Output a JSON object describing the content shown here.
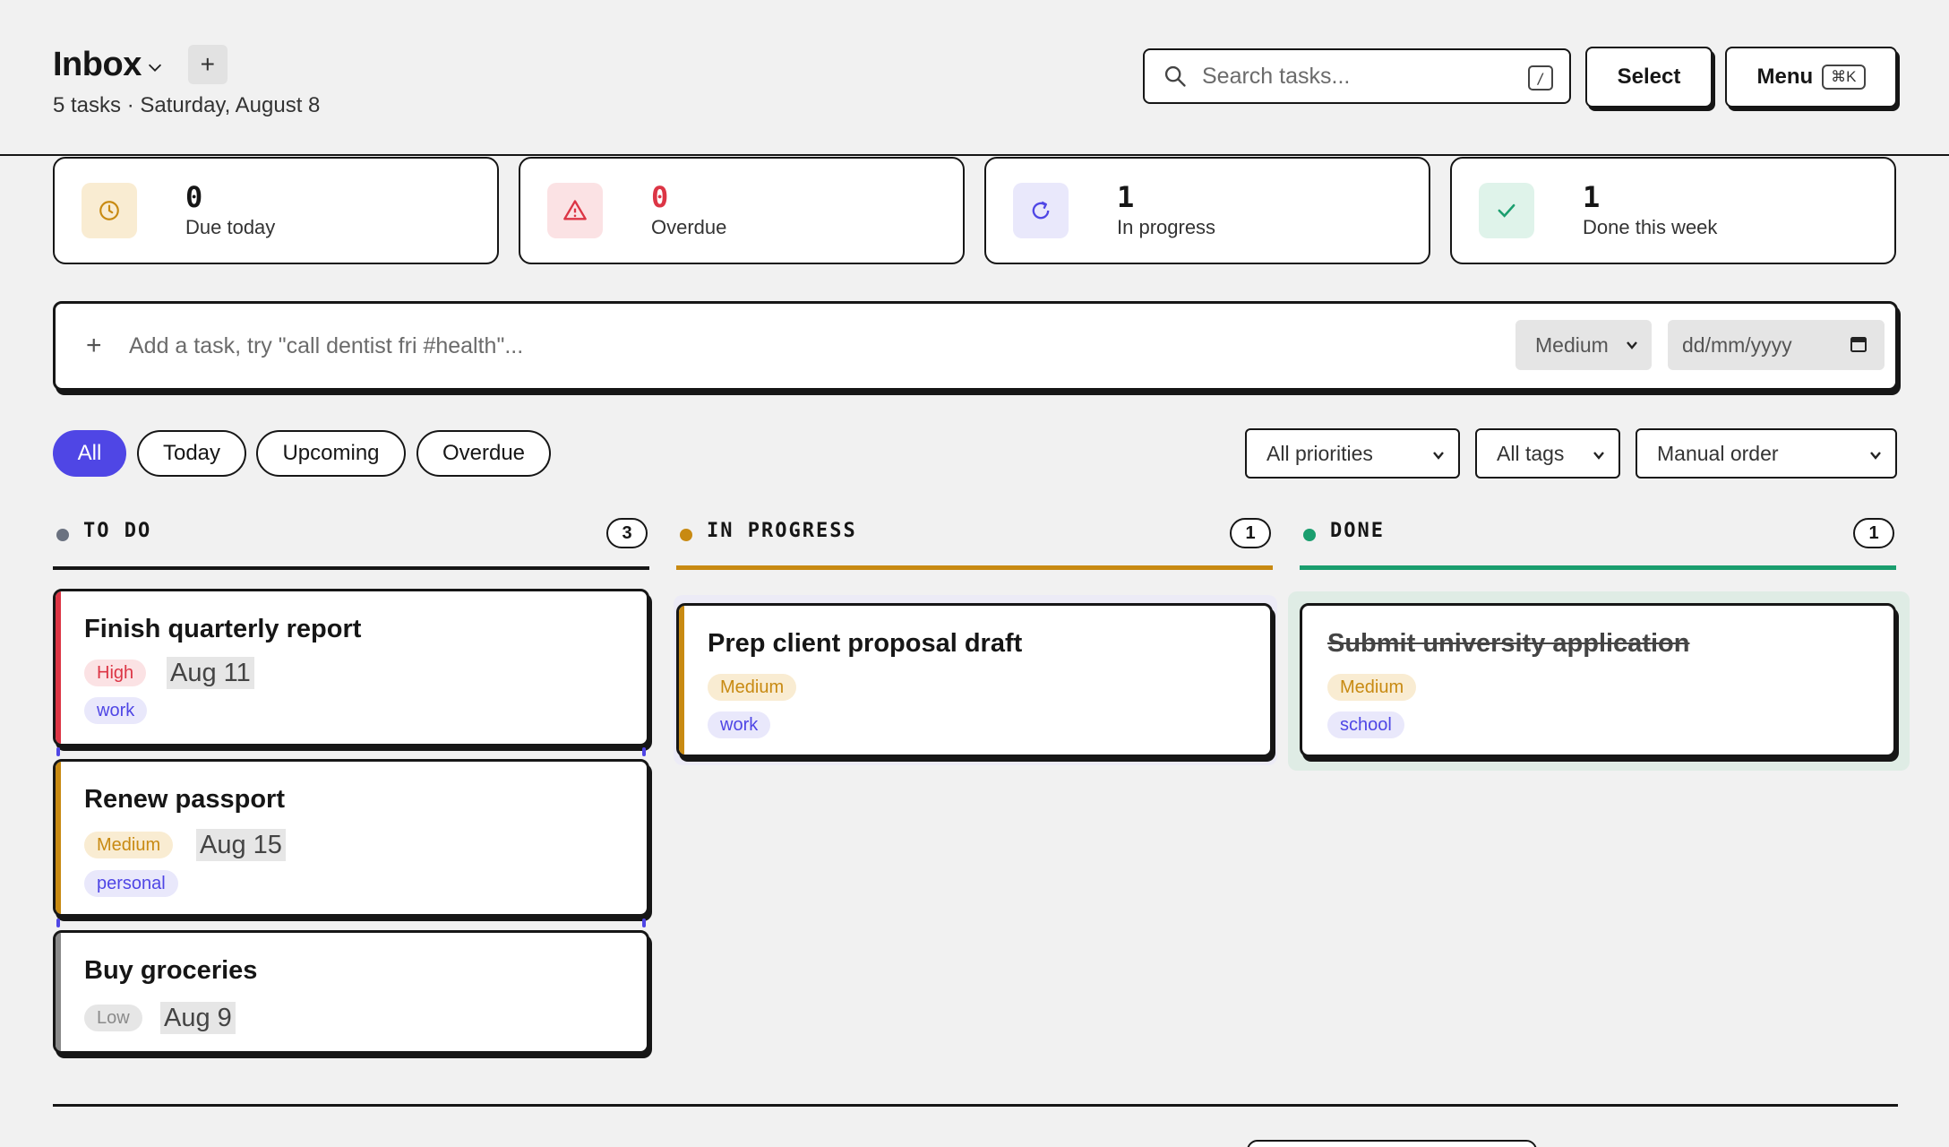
{
  "header": {
    "title": "Inbox",
    "subtitle": "5 tasks · Saturday, August 8",
    "add_label": "+",
    "search_placeholder": "Search tasks...",
    "search_shortcut": "/",
    "select_label": "Select",
    "menu_label": "Menu",
    "menu_shortcut": "⌘K"
  },
  "stats": [
    {
      "value": "0",
      "label": "Due today",
      "icon": "clock-icon",
      "color": "#c88a12"
    },
    {
      "value": "0",
      "label": "Overdue",
      "icon": "warning-icon",
      "color": "#dc3545"
    },
    {
      "value": "1",
      "label": "In progress",
      "icon": "refresh-icon",
      "color": "#4f46e5"
    },
    {
      "value": "1",
      "label": "Done this week",
      "icon": "check-icon",
      "color": "#1a9e6e"
    }
  ],
  "quick_add": {
    "placeholder": "Add a task, try \"call dentist fri #health\"...",
    "priority": "Medium",
    "date_placeholder": "dd/mm/yyyy"
  },
  "filters": {
    "tabs": [
      "All",
      "Today",
      "Upcoming",
      "Overdue"
    ],
    "active_tab": "All",
    "priority": "All priorities",
    "tags": "All tags",
    "order": "Manual order"
  },
  "columns": [
    {
      "name": "TO DO",
      "count": "3",
      "color": "#6b7280"
    },
    {
      "name": "IN PROGRESS",
      "count": "1",
      "color": "#c88a12"
    },
    {
      "name": "DONE",
      "count": "1",
      "color": "#1a9e6e"
    }
  ],
  "cards": {
    "todo": [
      {
        "title": "Finish quarterly report",
        "priority": "High",
        "due": "Aug 11",
        "tag": "work"
      },
      {
        "title": "Renew passport",
        "priority": "Medium",
        "due": "Aug 15",
        "tag": "personal"
      },
      {
        "title": "Buy groceries",
        "priority": "Low",
        "due": "Aug 9",
        "tag": ""
      }
    ],
    "in_progress": [
      {
        "title": "Prep client proposal draft",
        "priority": "Medium",
        "tag": "work"
      }
    ],
    "done": [
      {
        "title": "Submit university application",
        "priority": "Medium",
        "tag": "school"
      }
    ]
  },
  "colors": {
    "accent": "#4f46e5",
    "high": "#dc3545",
    "medium": "#c88a12",
    "low": "#8a8a8a",
    "done": "#1a9e6e"
  }
}
